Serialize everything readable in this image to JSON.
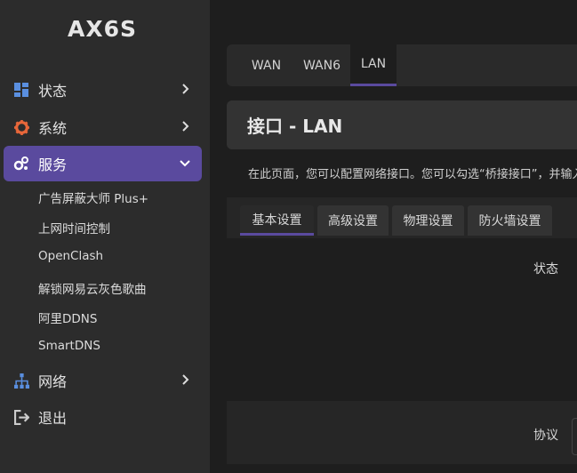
{
  "brand": "AX6S",
  "sidebar": {
    "items": [
      {
        "label": "状态",
        "icon": "dashboard-icon"
      },
      {
        "label": "系统",
        "icon": "gear-icon"
      },
      {
        "label": "服务",
        "icon": "services-icon"
      },
      {
        "label": "网络",
        "icon": "network-icon"
      },
      {
        "label": "退出",
        "icon": "logout-icon"
      }
    ],
    "submenu": [
      "广告屏蔽大师 Plus+",
      "上网时间控制",
      "OpenClash",
      "解锁网易云灰色歌曲",
      "阿里DDNS",
      "SmartDNS"
    ]
  },
  "main": {
    "tabs": [
      "WAN",
      "WAN6",
      "LAN"
    ],
    "active_tab": "LAN",
    "page_title": "接口 - LAN",
    "description": "在此页面，您可以配置网络接口。您可以勾选“桥接接口”，并输入",
    "sub_tabs": [
      "基本设置",
      "高级设置",
      "物理设置",
      "防火墙设置"
    ],
    "active_sub_tab": "基本设置",
    "fields": {
      "status_label": "状态",
      "protocol_label": "协议"
    }
  },
  "colors": {
    "accent": "#5a4a9e",
    "sidebar_bg": "#2c2c2c",
    "main_bg": "#1e1e1e",
    "icon_blue": "#5a8fe0",
    "icon_orange": "#e8673a"
  }
}
